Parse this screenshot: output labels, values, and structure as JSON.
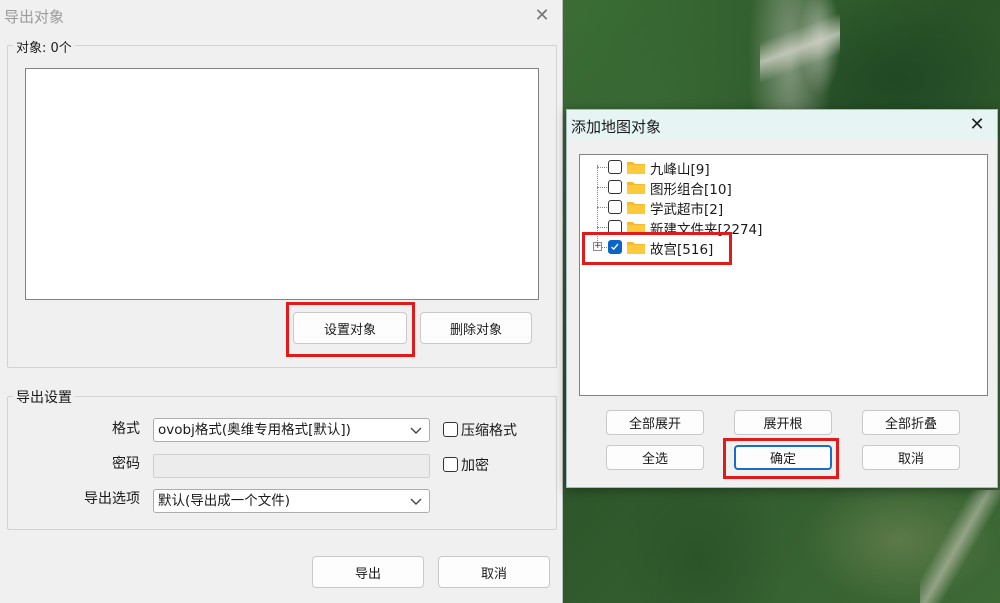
{
  "export_dialog": {
    "title": "导出对象",
    "objects_group_label": "对象: 0个",
    "set_objects_button": "设置对象",
    "delete_objects_button": "删除对象",
    "settings_group_label": "导出设置",
    "format_label": "格式",
    "format_value": "ovobj格式(奥维专用格式[默认])",
    "compress_label": "压缩格式",
    "password_label": "密码",
    "encrypt_label": "加密",
    "export_options_label": "导出选项",
    "export_options_value": "默认(导出成一个文件)",
    "export_button": "导出",
    "cancel_button": "取消"
  },
  "add_dialog": {
    "title": "添加地图对象",
    "tree_items": [
      {
        "label": "九峰山[9]",
        "checked": false
      },
      {
        "label": "图形组合[10]",
        "checked": false
      },
      {
        "label": "学武超市[2]",
        "checked": false
      },
      {
        "label": "新建文件夹[2274]",
        "checked": false
      },
      {
        "label": "故宫[516]",
        "checked": true
      }
    ],
    "expand_all_button": "全部展开",
    "expand_root_button": "展开根",
    "collapse_all_button": "全部折叠",
    "select_all_button": "全选",
    "ok_button": "确定",
    "cancel_button": "取消"
  },
  "colors": {
    "highlight": "#e01b1b",
    "checkbox_checked": "#0a64c9",
    "folder": "#f5b82e"
  }
}
